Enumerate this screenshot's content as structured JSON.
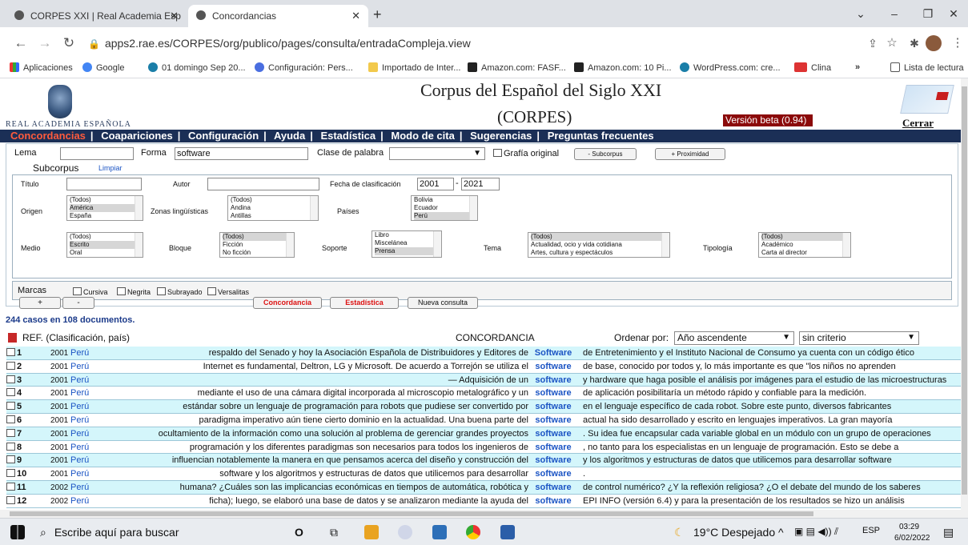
{
  "browser": {
    "tabs": [
      {
        "title": "CORPES XXI | Real Academia Esp"
      },
      {
        "title": "Concordancias"
      }
    ],
    "new_tab": "+",
    "url": "apps2.rae.es/CORPES/org/publico/pages/consulta/entradaCompleja.view",
    "bookmarks": [
      "Aplicaciones",
      "Google",
      "01 domingo Sep 20...",
      "Configuración: Pers...",
      "Importado de Inter...",
      "Amazon.com: FASF...",
      "Amazon.com: 10 Pi...",
      "WordPress.com: cre...",
      "Clina"
    ],
    "reading_list": "Lista de lectura",
    "more": "»"
  },
  "header": {
    "org": "REAL ACADEMIA ESPAÑOLA",
    "title_line1": "Corpus del Español del Siglo XXI",
    "title_line2": "(CORPES)",
    "version": "Versión beta (0.94)",
    "logout": "Cerrar sesión"
  },
  "menu": [
    "Concordancias",
    "Coapariciones",
    "Configuración",
    "Ayuda",
    "Estadística",
    "Modo de cita",
    "Sugerencias",
    "Preguntas frecuentes"
  ],
  "search": {
    "lema_label": "Lema",
    "lema_value": "",
    "forma_label": "Forma",
    "forma_value": "software",
    "clase_label": "Clase de palabra",
    "clase_value": "",
    "grafia_label": "Grafía original",
    "subcorpus_btn": "- Subcorpus",
    "proximidad_btn": "+ Proximidad",
    "subcorpus_label": "Subcorpus",
    "limpiar": "Limpiar"
  },
  "filters": {
    "titulo_label": "Título",
    "autor_label": "Autor",
    "fecha_label": "Fecha de clasificación",
    "fecha_from": "2001",
    "fecha_dash": "-",
    "fecha_to": "2021",
    "origen_label": "Origen",
    "origen_options": [
      "(Todos)",
      "América",
      "España"
    ],
    "zonas_label": "Zonas lingüísticas",
    "zonas_options": [
      "(Todos)",
      "Andina",
      "Antillas"
    ],
    "paises_label": "Países",
    "paises_options": [
      "Bolivia",
      "Ecuador",
      "Perú"
    ],
    "medio_label": "Medio",
    "medio_options": [
      "(Todos)",
      "Escrito",
      "Oral"
    ],
    "bloque_label": "Bloque",
    "bloque_options": [
      "(Todos)",
      "Ficción",
      "No ficción"
    ],
    "soporte_label": "Soporte",
    "soporte_options": [
      "Libro",
      "Miscelánea",
      "Prensa"
    ],
    "tema_label": "Tema",
    "tema_options": [
      "(Todos)",
      "Actualidad, ocio y vida cotidiana",
      "Artes, cultura y espectáculos"
    ],
    "tipologia_label": "Tipología",
    "tipologia_options": [
      "(Todos)",
      "Académico",
      "Carta al director"
    ],
    "marcas_label": "Marcas",
    "marcas": [
      "Cursiva",
      "Negrita",
      "Subrayado",
      "Versalitas"
    ]
  },
  "actions": {
    "plus": "+",
    "minus": "-",
    "concordancia": "Concordancia",
    "estadistica": "Estadística",
    "nueva": "Nueva consulta"
  },
  "results": {
    "count_text": "244 casos en 108 documentos.",
    "ref_header": "REF. (Clasificación, país)",
    "conc_header": "CONCORDANCIA",
    "order_label": "Ordenar por:",
    "order_value": "Año ascendente",
    "order2_value": "sin criterio",
    "rows": [
      {
        "n": "1",
        "year": "2001",
        "country": "Perú",
        "left": "respaldo del Senado y hoy la Asociación Española de Distribuidores y Editores de",
        "kw": "Software",
        "right": "de Entretenimiento y el Instituto Nacional de Consumo ya cuenta con un código ético"
      },
      {
        "n": "2",
        "year": "2001",
        "country": "Perú",
        "left": "Internet es fundamental, Deltron, LG y Microsoft. De acuerdo a Torrejón se utiliza el",
        "kw": "software",
        "right": "de base, conocido por todos y, lo más importante es que \"los niños no aprenden"
      },
      {
        "n": "3",
        "year": "2001",
        "country": "Perú",
        "left": "— Adquisición de un",
        "kw": "software",
        "right": "y hardware que haga posible el análisis por imágenes para el estudio de las microestructuras"
      },
      {
        "n": "4",
        "year": "2001",
        "country": "Perú",
        "left": "mediante el uso de una cámara digital incorporada al microscopio metalográfico y un",
        "kw": "software",
        "right": "de aplicación posibilitaría un método rápido y confiable para la medición."
      },
      {
        "n": "5",
        "year": "2001",
        "country": "Perú",
        "left": "estándar sobre un lenguaje de programación para robots que pudiese ser convertido por",
        "kw": "software",
        "right": "en el lenguaje específico de cada robot. Sobre este punto, diversos fabricantes"
      },
      {
        "n": "6",
        "year": "2001",
        "country": "Perú",
        "left": "paradigma imperativo aún tiene cierto dominio en la actualidad. Una buena parte del",
        "kw": "software",
        "right": "actual ha sido desarrollado y escrito en lenguajes imperativos. La gran mayoría"
      },
      {
        "n": "7",
        "year": "2001",
        "country": "Perú",
        "left": "ocultamiento de la información como una solución al problema de gerenciar grandes proyectos",
        "kw": "software",
        "right": ". Su idea fue encapsular cada variable global en un módulo con un grupo de operaciones"
      },
      {
        "n": "8",
        "year": "2001",
        "country": "Perú",
        "left": "programación y los diferentes paradigmas son necesarios para todos los ingenieros de",
        "kw": "software",
        "right": ", no tanto para los especialistas en un lenguaje de programación. Esto se debe a"
      },
      {
        "n": "9",
        "year": "2001",
        "country": "Perú",
        "left": "influencian notablemente la manera en que pensamos acerca del diseño y construcción del",
        "kw": "software",
        "right": "y los algoritmos y estructuras de datos que utilicemos para desarrollar software"
      },
      {
        "n": "10",
        "year": "2001",
        "country": "Perú",
        "left": "software y los algoritmos y estructuras de datos que utilicemos para desarrollar",
        "kw": "software",
        "right": "."
      },
      {
        "n": "11",
        "year": "2002",
        "country": "Perú",
        "left": "humana? ¿Cuáles son las implicancias económicas en tiempos de automática, robótica y",
        "kw": "software",
        "right": "de control numérico? ¿Y la reflexión religiosa? ¿O el debate del mundo de los saberes"
      },
      {
        "n": "12",
        "year": "2002",
        "country": "Perú",
        "left": "ficha); luego, se elaboró una base de datos y se analizaron mediante la ayuda del",
        "kw": "software",
        "right": "EPI INFO (versión 6.4) y para la presentación de los resultados se hizo un análisis"
      }
    ]
  },
  "taskbar": {
    "search_placeholder": "Escribe aquí para buscar",
    "weather": "19°C  Despejado",
    "lang": "ESP",
    "time": "03:29",
    "date": "6/02/2022"
  },
  "colors": {
    "menu_bg": "#1b2f56",
    "menu_active": "#ff5b3d",
    "row_alt": "#d4f6fb",
    "keyword": "#1b54c4",
    "beta_bg": "#8b0a0a"
  }
}
